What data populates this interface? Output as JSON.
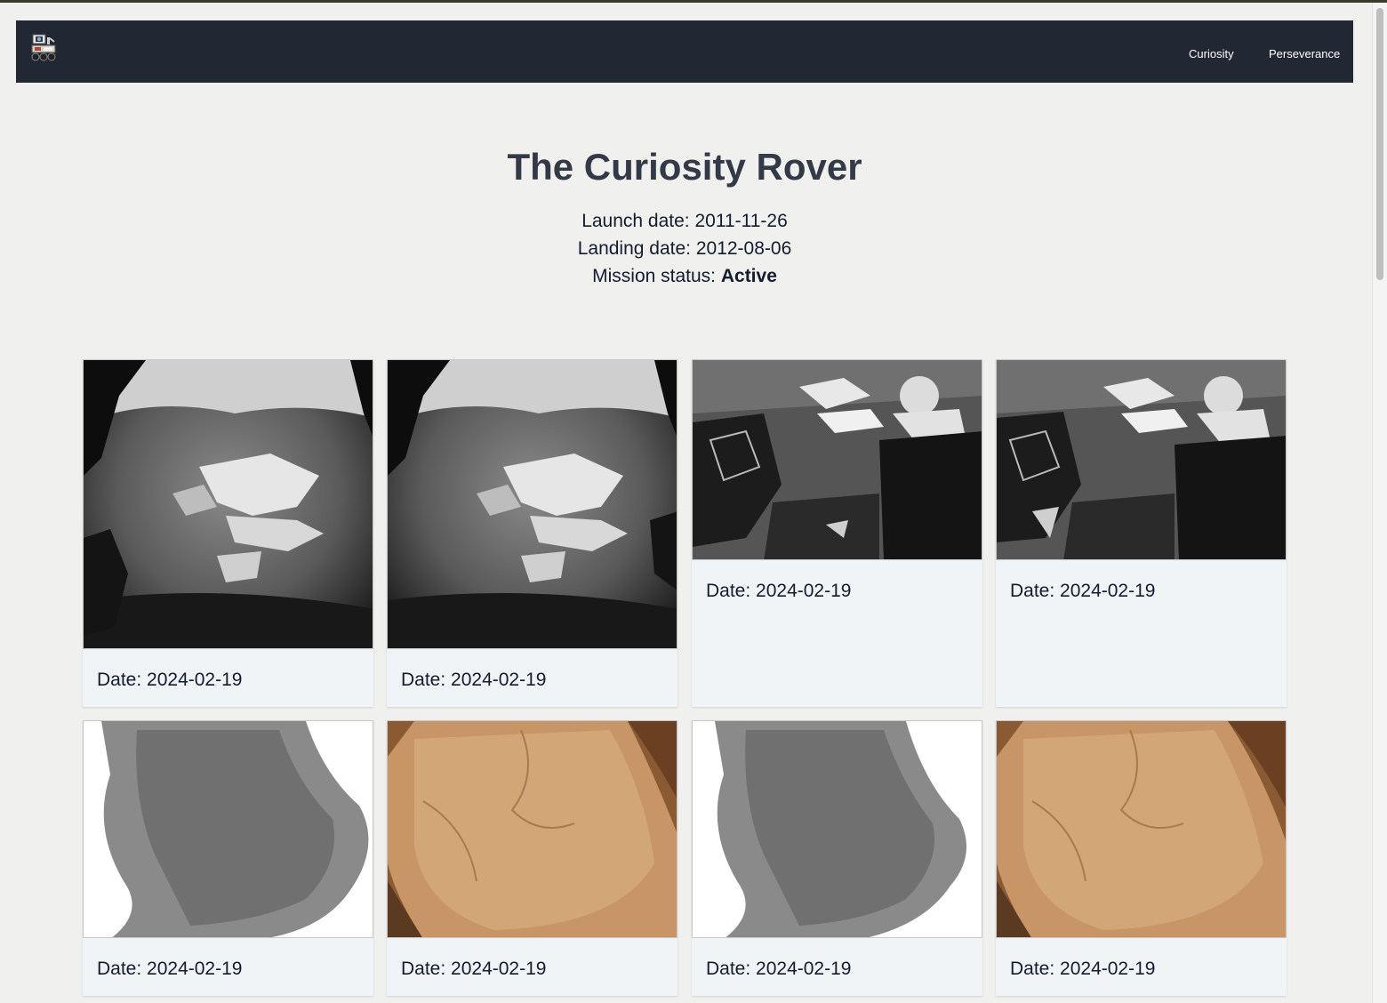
{
  "nav": {
    "logo_icon": "rover-logo-icon",
    "links": [
      "Curiosity",
      "Perseverance"
    ]
  },
  "rover": {
    "title": "The Curiosity Rover",
    "launch_label": "Launch date: ",
    "launch_date": "2011-11-26",
    "landing_label": "Landing date: ",
    "landing_date": "2012-08-06",
    "status_label": "Mission status: ",
    "status": "Active"
  },
  "photos": [
    {
      "date_label": "Date: 2024-02-19",
      "kind": "grayscale-terrain"
    },
    {
      "date_label": "Date: 2024-02-19",
      "kind": "grayscale-terrain"
    },
    {
      "date_label": "Date: 2024-02-19",
      "kind": "grayscale-wheel"
    },
    {
      "date_label": "Date: 2024-02-19",
      "kind": "grayscale-wheel"
    },
    {
      "date_label": "Date: 2024-02-19",
      "kind": "grayscale-blob"
    },
    {
      "date_label": "Date: 2024-02-19",
      "kind": "color-rock"
    },
    {
      "date_label": "Date: 2024-02-19",
      "kind": "grayscale-blob"
    },
    {
      "date_label": "Date: 2024-02-19",
      "kind": "color-rock"
    }
  ],
  "colors": {
    "navbar": "#212833",
    "background": "#f0f0ee",
    "card": "#f0f4f7",
    "title": "#343a45",
    "text": "#141c2e"
  }
}
